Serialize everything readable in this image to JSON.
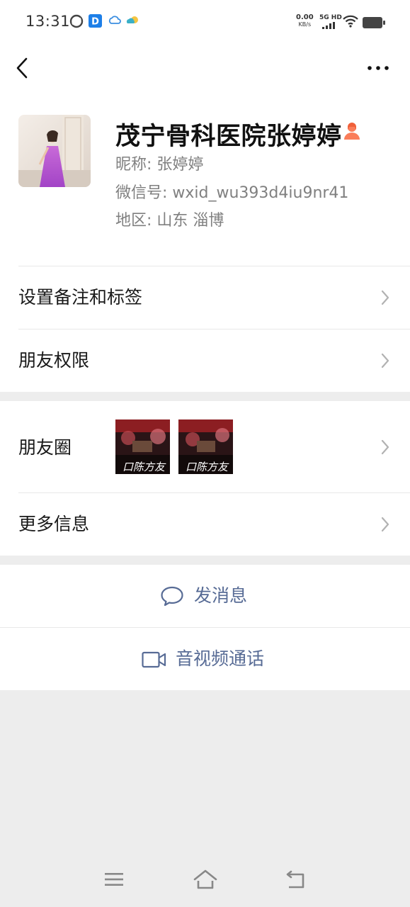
{
  "status_bar": {
    "time": "13:31",
    "net_speed_value": "0.00",
    "net_speed_unit": "KB/s",
    "signal_label": "5G HD",
    "icons": [
      "sync-icon",
      "app-d-icon",
      "weather-cloud-icon",
      "weather-sun-icon",
      "signal-icon",
      "wifi-icon",
      "battery-icon"
    ]
  },
  "nav": {
    "back_icon": "chevron-left-icon",
    "more_icon": "ellipsis-icon"
  },
  "profile": {
    "display_name": "茂宁骨科医院张婷婷",
    "gender_icon": "female-person-icon",
    "nickname": "昵称:  张婷婷",
    "wechat_id": "微信号:  wxid_wu393d4iu9nr41",
    "region": "地区:  山东  淄博"
  },
  "menu": {
    "set_remark": "设置备注和标签",
    "friend_permissions": "朋友权限",
    "moments": "朋友圈",
    "more_info": "更多信息"
  },
  "actions": {
    "send_message": "发消息",
    "video_call": "音视频通话"
  },
  "colors": {
    "link_blue": "#576b95",
    "page_bg": "#ededed",
    "gender_orange": "#fa7d5a"
  },
  "system_nav": {
    "icons": [
      "menu-icon",
      "home-icon",
      "back-icon"
    ]
  }
}
